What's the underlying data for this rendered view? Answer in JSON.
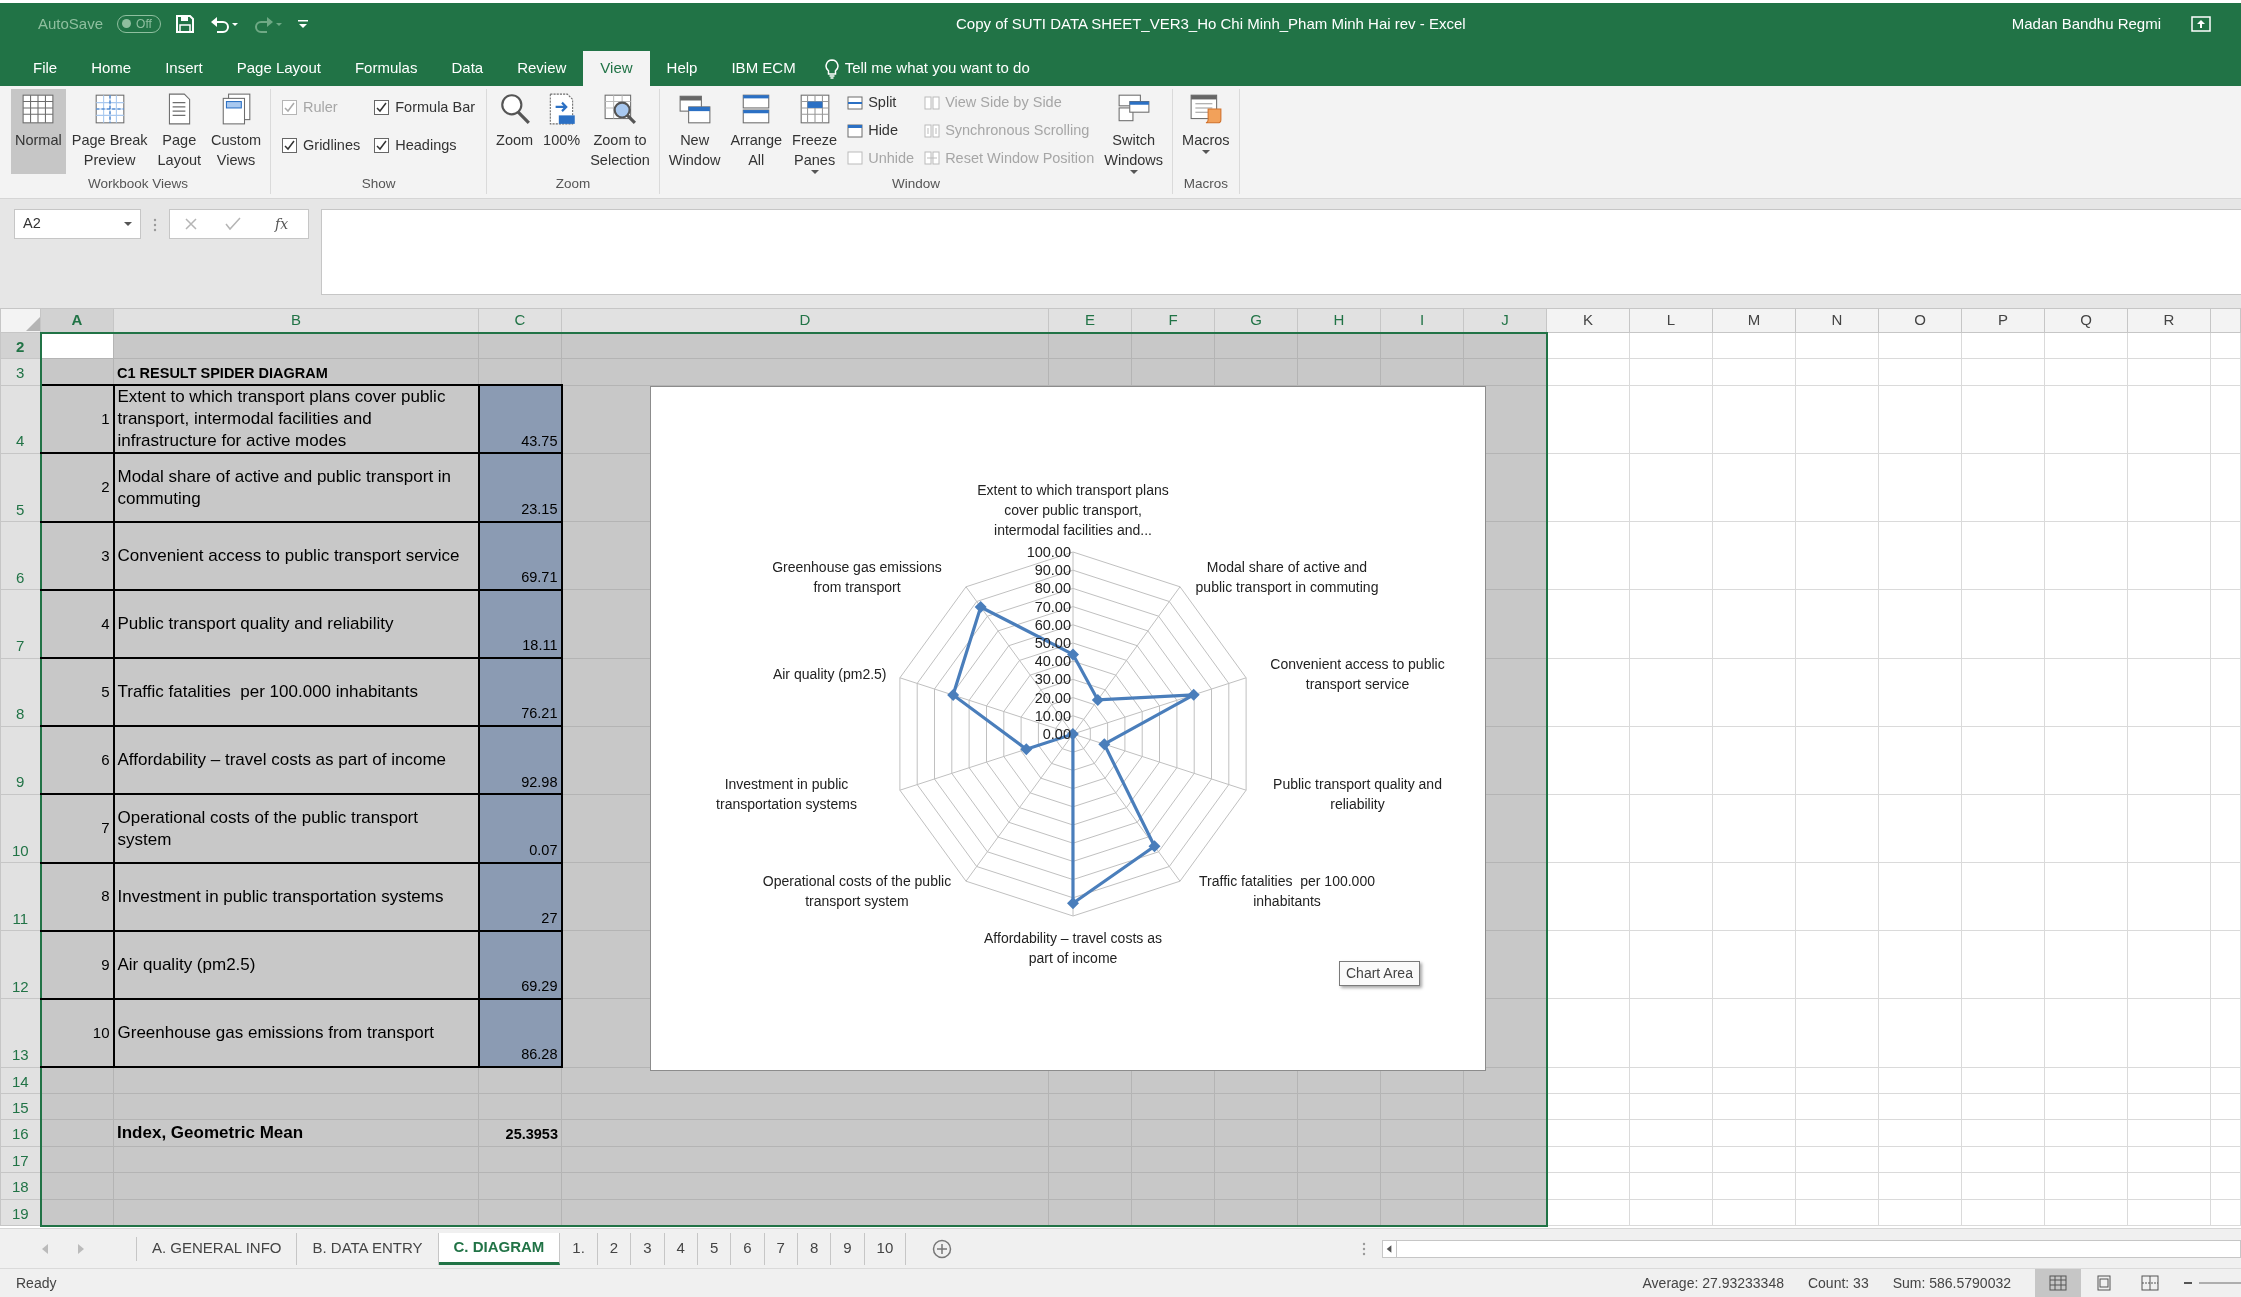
{
  "window": {
    "title": "Copy of SUTI DATA SHEET_VER3_Ho Chi Minh_Pham Minh Hai rev  -  Excel",
    "user": "Madan Bandhu Regmi"
  },
  "quick_access": {
    "autosave_label": "AutoSave",
    "autosave_state": "Off",
    "autosave_on": false
  },
  "menu_tabs": [
    {
      "label": "File",
      "selected": false
    },
    {
      "label": "Home",
      "selected": false
    },
    {
      "label": "Insert",
      "selected": false
    },
    {
      "label": "Page Layout",
      "selected": false
    },
    {
      "label": "Formulas",
      "selected": false
    },
    {
      "label": "Data",
      "selected": false
    },
    {
      "label": "Review",
      "selected": false
    },
    {
      "label": "View",
      "selected": true
    },
    {
      "label": "Help",
      "selected": false
    },
    {
      "label": "IBM ECM",
      "selected": false
    }
  ],
  "tell_me": {
    "placeholder": "Tell me what you want to do"
  },
  "ribbon": {
    "groups": [
      {
        "title": "Workbook Views",
        "items": [
          {
            "kind": "large",
            "label": "Normal",
            "selected": true,
            "disabled": false
          },
          {
            "kind": "large",
            "label": "Page Break\nPreview",
            "selected": false,
            "disabled": false
          },
          {
            "kind": "large",
            "label": "Page\nLayout",
            "selected": false,
            "disabled": false
          },
          {
            "kind": "large",
            "label": "Custom\nViews",
            "selected": false,
            "disabled": false
          }
        ]
      },
      {
        "title": "Show",
        "items": [
          {
            "kind": "check",
            "label": "Ruler",
            "checked": true,
            "disabled": true
          },
          {
            "kind": "check",
            "label": "Gridlines",
            "checked": true,
            "disabled": false
          },
          {
            "kind": "check",
            "label": "Formula Bar",
            "checked": true,
            "disabled": false
          },
          {
            "kind": "check",
            "label": "Headings",
            "checked": true,
            "disabled": false
          }
        ]
      },
      {
        "title": "Zoom",
        "items": [
          {
            "kind": "large",
            "label": "Zoom",
            "selected": false,
            "disabled": false
          },
          {
            "kind": "large",
            "label": "100%",
            "selected": false,
            "disabled": false
          },
          {
            "kind": "large",
            "label": "Zoom to\nSelection",
            "selected": false,
            "disabled": false
          }
        ]
      },
      {
        "title": "Window",
        "items": [
          {
            "kind": "large",
            "label": "New\nWindow",
            "selected": false,
            "disabled": false
          },
          {
            "kind": "large",
            "label": "Arrange\nAll",
            "selected": false,
            "disabled": false
          },
          {
            "kind": "large",
            "label": "Freeze\nPanes",
            "selected": false,
            "disabled": false,
            "dropdown": true
          },
          {
            "kind": "small",
            "label": "Split",
            "disabled": false
          },
          {
            "kind": "small",
            "label": "Hide",
            "disabled": false
          },
          {
            "kind": "small",
            "label": "Unhide",
            "disabled": true
          },
          {
            "kind": "small",
            "label": "View Side by Side",
            "disabled": true
          },
          {
            "kind": "small",
            "label": "Synchronous Scrolling",
            "disabled": true
          },
          {
            "kind": "small",
            "label": "Reset Window Position",
            "disabled": true
          },
          {
            "kind": "large",
            "label": "Switch\nWindows",
            "selected": false,
            "disabled": false,
            "dropdown": true
          }
        ]
      },
      {
        "title": "Macros",
        "items": [
          {
            "kind": "large",
            "label": "Macros",
            "selected": false,
            "disabled": false,
            "dropdown": true
          }
        ]
      }
    ]
  },
  "formula_bar": {
    "name_box": "A2",
    "fx": "fx"
  },
  "sheet": {
    "columns": [
      {
        "label": "A",
        "selected": true,
        "active": true
      },
      {
        "label": "B",
        "selected": true,
        "active": false
      },
      {
        "label": "C",
        "selected": true,
        "active": false
      },
      {
        "label": "D",
        "selected": true,
        "active": false
      },
      {
        "label": "E",
        "selected": true,
        "active": false
      },
      {
        "label": "F",
        "selected": true,
        "active": false
      },
      {
        "label": "G",
        "selected": true,
        "active": false
      },
      {
        "label": "H",
        "selected": true,
        "active": false
      },
      {
        "label": "I",
        "selected": true,
        "active": false
      },
      {
        "label": "J",
        "selected": true,
        "active": false
      },
      {
        "label": "K",
        "selected": false,
        "active": false
      },
      {
        "label": "L",
        "selected": false,
        "active": false
      },
      {
        "label": "M",
        "selected": false,
        "active": false
      },
      {
        "label": "N",
        "selected": false,
        "active": false
      },
      {
        "label": "O",
        "selected": false,
        "active": false
      },
      {
        "label": "P",
        "selected": false,
        "active": false
      },
      {
        "label": "Q",
        "selected": false,
        "active": false
      },
      {
        "label": "R",
        "selected": false,
        "active": false
      }
    ],
    "rows": [
      {
        "header": "2",
        "kind": "blank",
        "selected": true,
        "active": true,
        "cells": {}
      },
      {
        "header": "3",
        "kind": "title",
        "selected": true,
        "active": false,
        "cells": {
          "B": "C1 RESULT SPIDER DIAGRAM"
        }
      },
      {
        "header": "4",
        "kind": "item",
        "selected": true,
        "active": false,
        "cells": {
          "A": "1",
          "B": "Extent to which transport plans cover public transport, intermodal facilities and infrastructure for active modes",
          "C": "43.75"
        }
      },
      {
        "header": "5",
        "kind": "item",
        "selected": true,
        "active": false,
        "cells": {
          "A": "2",
          "B": "Modal share of active and public transport in commuting",
          "C": "23.15"
        }
      },
      {
        "header": "6",
        "kind": "item",
        "selected": true,
        "active": false,
        "cells": {
          "A": "3",
          "B": "Convenient access to public transport service",
          "C": "69.71"
        }
      },
      {
        "header": "7",
        "kind": "item",
        "selected": true,
        "active": false,
        "cells": {
          "A": "4",
          "B": "Public transport quality and reliability",
          "C": "18.11"
        }
      },
      {
        "header": "8",
        "kind": "item",
        "selected": true,
        "active": false,
        "cells": {
          "A": "5",
          "B": "Traffic fatalities  per 100.000 inhabitants",
          "C": "76.21"
        }
      },
      {
        "header": "9",
        "kind": "item",
        "selected": true,
        "active": false,
        "cells": {
          "A": "6",
          "B": "Affordability – travel costs as part of income",
          "C": "92.98"
        }
      },
      {
        "header": "10",
        "kind": "item",
        "selected": true,
        "active": false,
        "cells": {
          "A": "7",
          "B": "Operational costs of the public transport system",
          "C": "0.07"
        }
      },
      {
        "header": "11",
        "kind": "item",
        "selected": true,
        "active": false,
        "cells": {
          "A": "8",
          "B": "Investment in public transportation systems",
          "C": "27"
        }
      },
      {
        "header": "12",
        "kind": "item",
        "selected": true,
        "active": false,
        "cells": {
          "A": "9",
          "B": "Air quality (pm2.5)",
          "C": "69.29"
        }
      },
      {
        "header": "13",
        "kind": "item",
        "selected": true,
        "active": false,
        "cells": {
          "A": "10",
          "B": "Greenhouse gas emissions from transport",
          "C": "86.28"
        }
      },
      {
        "header": "14",
        "kind": "blank",
        "selected": true,
        "active": false,
        "cells": {}
      },
      {
        "header": "15",
        "kind": "blank",
        "selected": true,
        "active": false,
        "cells": {}
      },
      {
        "header": "16",
        "kind": "total",
        "selected": true,
        "active": false,
        "cells": {
          "B": "Index, Geometric Mean",
          "C": "25.3953"
        }
      },
      {
        "header": "17",
        "kind": "blank",
        "selected": true,
        "active": false,
        "cells": {}
      },
      {
        "header": "18",
        "kind": "blank",
        "selected": true,
        "active": false,
        "cells": {}
      },
      {
        "header": "19",
        "kind": "blank",
        "selected": true,
        "active": false,
        "cells": {}
      }
    ]
  },
  "chart": {
    "tooltip": "Chart Area",
    "chart_data": {
      "type": "radar",
      "categories": [
        "Extent to which transport plans cover public transport, intermodal facilities and...",
        "Modal share of active and public transport in commuting",
        "Convenient access to public transport service",
        "Public transport quality and reliability",
        "Traffic fatalities  per 100.000 inhabitants",
        "Affordability – travel costs as part of income",
        "Operational costs of the public transport system",
        "Investment in public transportation systems",
        "Air quality (pm2.5)",
        "Greenhouse gas emissions from transport"
      ],
      "series": [
        {
          "color": "#4a7ebb",
          "values": [
            43.75,
            23.15,
            69.71,
            18.11,
            76.21,
            92.98,
            0.07,
            27,
            69.29,
            86.28
          ]
        }
      ],
      "ylim": [
        0,
        100
      ],
      "yticks": [
        {
          "value": 0,
          "label": "0.00"
        },
        {
          "value": 10,
          "label": "10.00"
        },
        {
          "value": 20,
          "label": "20.00"
        },
        {
          "value": 30,
          "label": "30.00"
        },
        {
          "value": 40,
          "label": "40.00"
        },
        {
          "value": 50,
          "label": "50.00"
        },
        {
          "value": 60,
          "label": "60.00"
        },
        {
          "value": 70,
          "label": "70.00"
        },
        {
          "value": 80,
          "label": "80.00"
        },
        {
          "value": 90,
          "label": "90.00"
        },
        {
          "value": 100,
          "label": "100.00"
        }
      ]
    }
  },
  "sheet_tabs": [
    {
      "label": "A. GENERAL INFO",
      "selected": false
    },
    {
      "label": "B. DATA ENTRY",
      "selected": false
    },
    {
      "label": "C. DIAGRAM",
      "selected": true
    },
    {
      "label": "1.",
      "selected": false
    },
    {
      "label": "2",
      "selected": false
    },
    {
      "label": "3",
      "selected": false
    },
    {
      "label": "4",
      "selected": false
    },
    {
      "label": "5",
      "selected": false
    },
    {
      "label": "6",
      "selected": false
    },
    {
      "label": "7",
      "selected": false
    },
    {
      "label": "8",
      "selected": false
    },
    {
      "label": "9",
      "selected": false
    },
    {
      "label": "10",
      "selected": false
    }
  ],
  "status_bar": {
    "mode": "Ready",
    "average": "Average: 27.93233348",
    "count": "Count: 33",
    "sum": "Sum: 586.5790032",
    "views": [
      {
        "selected": true
      },
      {
        "selected": false
      },
      {
        "selected": false
      }
    ]
  }
}
